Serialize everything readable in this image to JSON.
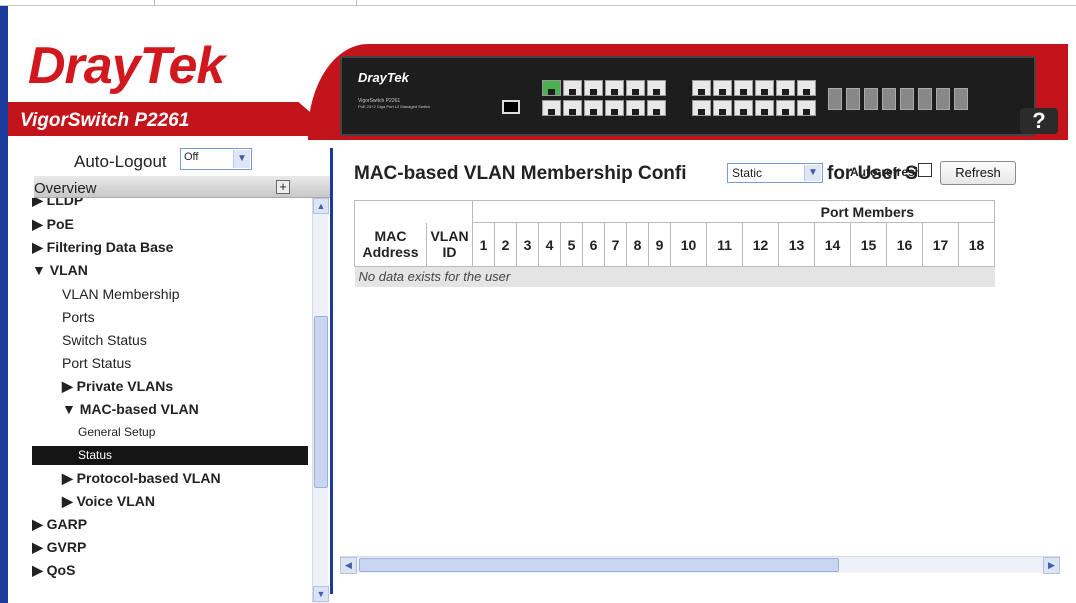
{
  "brand": {
    "logo_dray": "Dray",
    "logo_tek": "Tek",
    "model": "VigorSwitch P2261",
    "device_brand": "DrayTek",
    "device_model": "VigorSwitch P2261",
    "device_desc": "PoE 24+2 Giga Port L2 Managed Switch",
    "help_label": "?"
  },
  "sidebar": {
    "auto_logout_label": "Auto-Logout",
    "auto_logout_value": "Off",
    "overview_label": "Overview",
    "items": [
      {
        "label": "▶ LLDP",
        "level": "top"
      },
      {
        "label": "▶ PoE",
        "level": "top"
      },
      {
        "label": "▶ Filtering Data Base",
        "level": "top"
      },
      {
        "label": "▼ VLAN",
        "level": "top"
      },
      {
        "label": "VLAN Membership",
        "level": "sub"
      },
      {
        "label": "Ports",
        "level": "sub"
      },
      {
        "label": "Switch Status",
        "level": "sub"
      },
      {
        "label": "Port Status",
        "level": "sub"
      },
      {
        "label": "▶ Private VLANs",
        "level": "group"
      },
      {
        "label": "▼ MAC-based VLAN",
        "level": "group"
      },
      {
        "label": "General Setup",
        "level": "leaf"
      },
      {
        "label": "Status",
        "level": "leaf",
        "active": true
      },
      {
        "label": "▶ Protocol-based VLAN",
        "level": "group"
      },
      {
        "label": "▶ Voice VLAN",
        "level": "group"
      },
      {
        "label": "▶ GARP",
        "level": "top"
      },
      {
        "label": "▶ GVRP",
        "level": "top"
      },
      {
        "label": "▶ QoS",
        "level": "top"
      }
    ]
  },
  "main": {
    "title": "MAC-based VLAN Membership Confi",
    "user_select_value": "Static",
    "title_tail": "for User S",
    "title_end": "t",
    "auto_refresh_label": "Auto-refresh",
    "refresh_label": "Refresh",
    "table": {
      "col_mac": "MAC Address",
      "col_vlan": "VLAN ID",
      "port_members_label": "Port Members",
      "ports": [
        "1",
        "2",
        "3",
        "4",
        "5",
        "6",
        "7",
        "8",
        "9",
        "10",
        "11",
        "12",
        "13",
        "14",
        "15",
        "16",
        "17",
        "18"
      ],
      "empty_message": "No data exists for the user"
    }
  },
  "colors": {
    "brand_red": "#c3141c",
    "nav_blue": "#1a3a9c",
    "active_bg": "#151515"
  }
}
